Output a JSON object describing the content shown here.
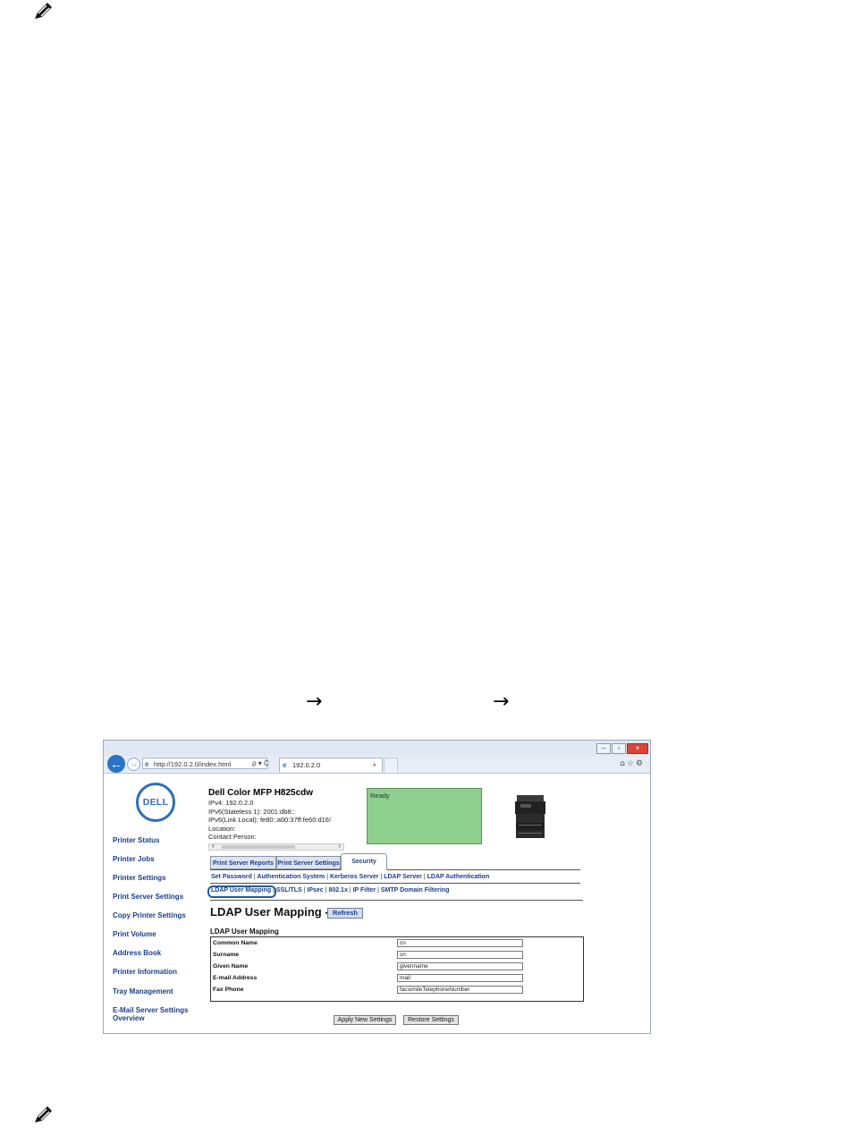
{
  "browser": {
    "address": "http://192.0.2.0/index.html",
    "address_tools": "ρ ▾ C",
    "tab_title": "192.0.2.0",
    "tab_close": "×",
    "win_min": "–",
    "win_max": "▫",
    "win_close": "×",
    "right_icons": "⌂☆⚙"
  },
  "logo_text": "DELL",
  "sidebar": {
    "items": [
      "Printer Status",
      "Printer Jobs",
      "Printer Settings",
      "Print Server Settings",
      "Copy Printer Settings",
      "Print Volume",
      "Address Book",
      "Printer Information",
      "Tray Management",
      "E-Mail Server Settings",
      "Overview"
    ]
  },
  "printer": {
    "title": "Dell Color MFP H825cdw",
    "info": [
      "IPv4: 192.0.2.0",
      "IPv6(Stateless 1): 2001:db8::",
      "IPv6(Link Local): fe80::a00:37ff:fe60:d16!",
      "Location:",
      "Contact Person:"
    ],
    "status": "Ready"
  },
  "tabs": [
    "Print Server Reports",
    "Print Server Settings",
    "Security"
  ],
  "sublinks_row1": [
    "Set Password",
    "Authentication System",
    "Kerberos Server",
    "LDAP Server",
    "LDAP Authentication"
  ],
  "sublinks_row2": [
    "LDAP User Mapping",
    "SSL/TLS",
    "IPsec",
    "802.1x",
    "IP Filter",
    "SMTP Domain Filtering"
  ],
  "heading": "LDAP User Mapping -",
  "refresh_label": "Refresh",
  "section_title": "LDAP User Mapping",
  "mapping": [
    {
      "label": "Common Name",
      "value": "cn"
    },
    {
      "label": "Surname",
      "value": "sn"
    },
    {
      "label": "Given Name",
      "value": "givenname"
    },
    {
      "label": "E-mail Address",
      "value": "mail"
    },
    {
      "label": "Fax Phone",
      "value": "facsimileTelephoneNumber"
    }
  ],
  "buttons": {
    "apply": "Apply New Settings",
    "restore": "Restore Settings"
  },
  "arrow_glyph": "→",
  "separator": "|"
}
